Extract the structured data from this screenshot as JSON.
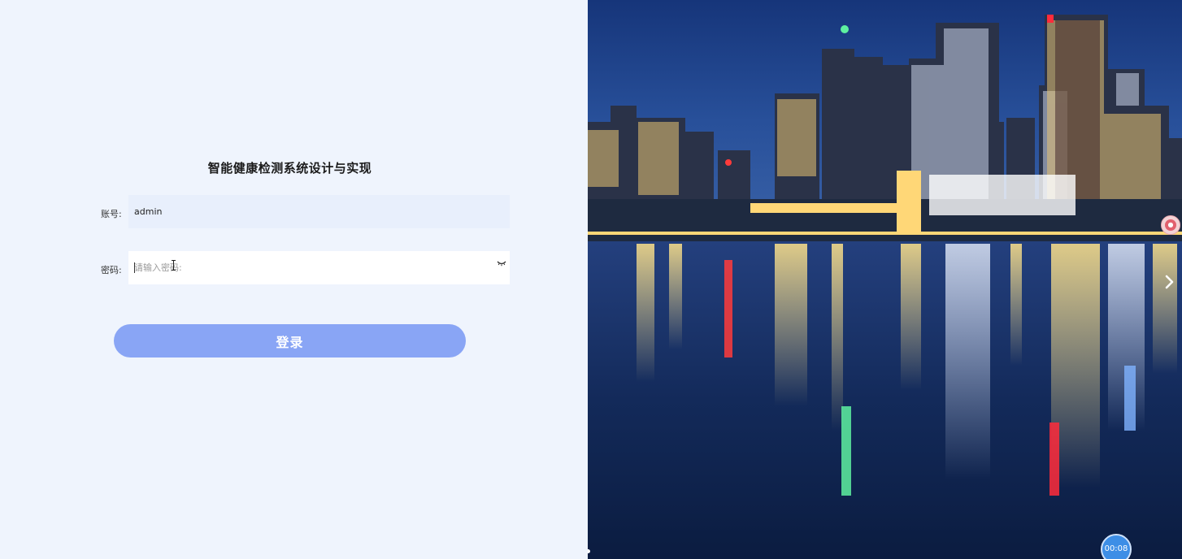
{
  "login": {
    "title": "智能健康检测系统设计与实现",
    "account_label": "账号:",
    "account_value": "admin",
    "password_label": "密码:",
    "password_placeholder": "请输入密码:",
    "submit_label": "登录"
  },
  "slideshow": {
    "timer": "00:08",
    "next_icon": "chevron-right-icon"
  },
  "colors": {
    "panel_bg": "#eff4fd",
    "button_bg": "#89a5f5",
    "account_bg": "#e8effc",
    "timer_bg": "#3d8ee6"
  }
}
